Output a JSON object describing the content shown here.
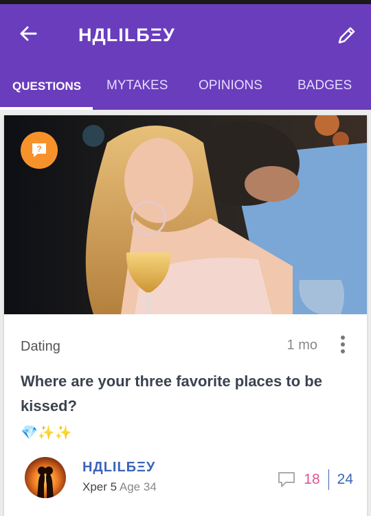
{
  "header": {
    "title": "НДLILБΞУ"
  },
  "tabs": [
    {
      "label": "QUESTIONS",
      "active": true
    },
    {
      "label": "MYTAKES"
    },
    {
      "label": "OPINIONS"
    },
    {
      "label": "BADGES"
    }
  ],
  "post": {
    "category": "Dating",
    "time": "1 mo",
    "question": "Where are your three favorite places to be kissed?",
    "emojis": "💎✨✨",
    "author": {
      "name": "НДLILБΞУ",
      "xper": "Xper 5",
      "age": "Age 34"
    },
    "stats": {
      "replies": "18",
      "views": "24"
    }
  },
  "colors": {
    "brand": "#6a3dbd",
    "accent": "#f7922b",
    "pink": "#e0538f",
    "link": "#3a64b8"
  },
  "icons": [
    "back-arrow-icon",
    "pencil-icon",
    "question-badge-icon",
    "more-vertical-icon",
    "comment-icon"
  ]
}
